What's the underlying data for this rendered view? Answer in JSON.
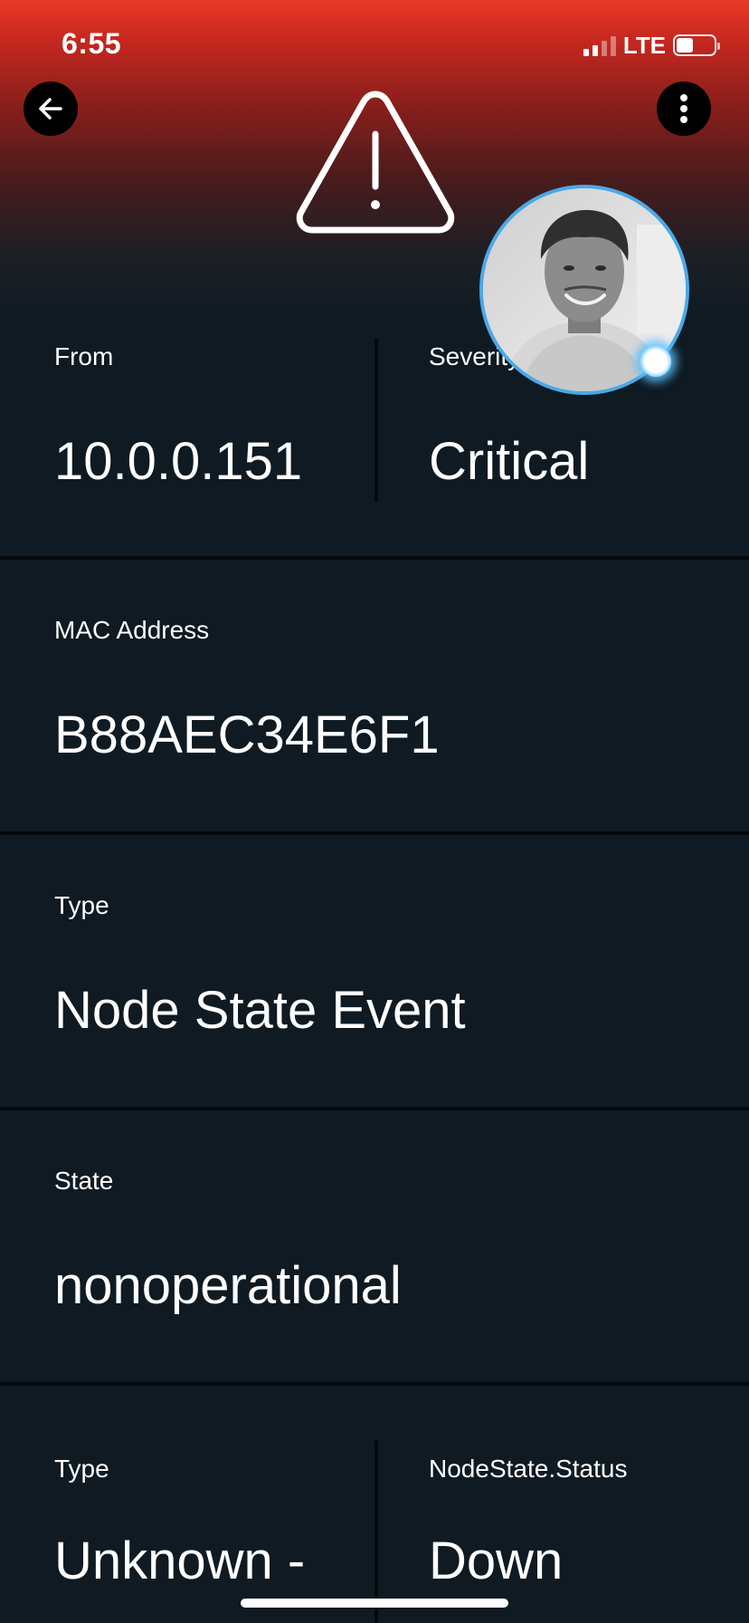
{
  "status_bar": {
    "time": "6:55",
    "network": "LTE",
    "signal_bars_active": 2,
    "signal_bars_total": 4,
    "battery_level": 0.45
  },
  "header": {
    "back_icon": "arrow-left-icon",
    "menu_icon": "more-vertical-icon",
    "alert_icon": "warning-triangle-icon",
    "gradient_top": "#e93a28",
    "gradient_bottom": "#0f1a22"
  },
  "avatar": {
    "presence_color": "#4aa8e8"
  },
  "fields": {
    "from": {
      "label": "From",
      "value": "10.0.0.151"
    },
    "severity": {
      "label": "Severity",
      "value": "Critical"
    },
    "mac": {
      "label": "MAC Address",
      "value": "B88AEC34E6F1"
    },
    "type": {
      "label": "Type",
      "value": "Node State Event"
    },
    "state": {
      "label": "State",
      "value": "nonoperational"
    },
    "type2": {
      "label": "Type",
      "value": "Unknown -"
    },
    "node_status": {
      "label": "NodeState.Status",
      "value": "Down"
    }
  },
  "theme": {
    "background": "#0f1a22",
    "divider": "#05090c",
    "text": "#ffffff"
  }
}
